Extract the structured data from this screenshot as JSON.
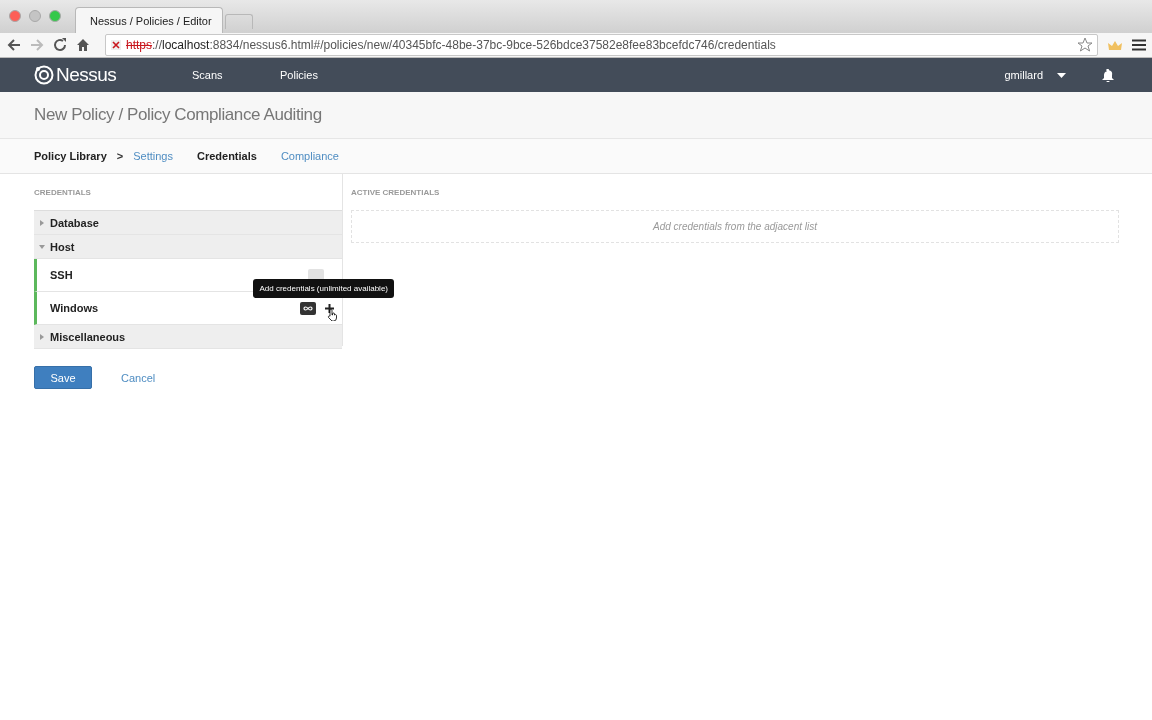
{
  "browser": {
    "tab_title": "Nessus / Policies / Editor",
    "url": {
      "scheme": "https",
      "separator": "://",
      "host": "localhost",
      "path": ":8834/nessus6.html#/policies/new/40345bfc-48be-37bc-9bce-526bdce37582e8fee83bcefdc746/credentials"
    }
  },
  "navbar": {
    "logo": "Nessus",
    "items": [
      {
        "label": "Scans"
      },
      {
        "label": "Policies"
      }
    ],
    "user": "gmillard"
  },
  "page_title": "New Policy / Policy Compliance Auditing",
  "breadcrumb": {
    "root": "Policy Library",
    "separator": ">",
    "tabs": [
      {
        "label": "Settings",
        "selected": false
      },
      {
        "label": "Credentials",
        "selected": true
      },
      {
        "label": "Compliance",
        "selected": false
      }
    ]
  },
  "credentials": {
    "heading": "CREDENTIALS",
    "groups": [
      {
        "label": "Database",
        "expanded": false
      },
      {
        "label": "Host",
        "expanded": true,
        "children": [
          {
            "label": "SSH",
            "hovered": false
          },
          {
            "label": "Windows",
            "hovered": true
          }
        ]
      },
      {
        "label": "Miscellaneous",
        "expanded": false
      }
    ]
  },
  "tooltip": "Add credentials (unlimited available)",
  "active_credentials": {
    "heading": "ACTIVE CREDENTIALS",
    "empty_text": "Add credentials from the adjacent list"
  },
  "buttons": [
    {
      "label": "Save",
      "kind": "primary"
    },
    {
      "label": "Cancel",
      "kind": "link"
    }
  ]
}
